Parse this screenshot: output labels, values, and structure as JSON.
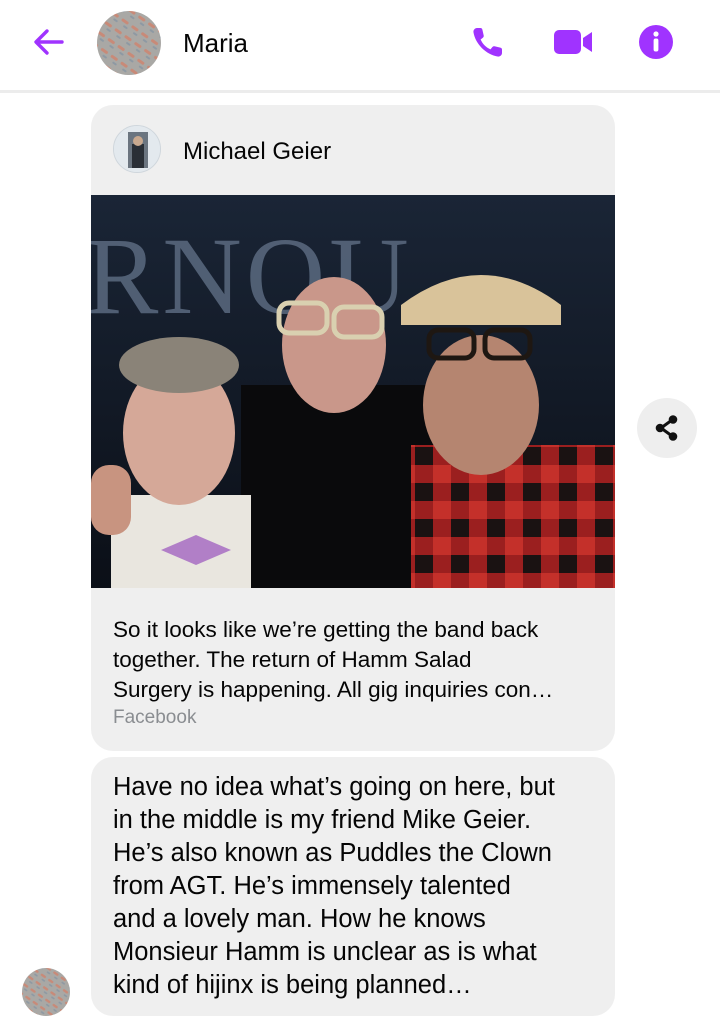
{
  "header": {
    "contact_name": "Maria",
    "back_icon": "arrow-left-icon",
    "actions": [
      "phone-icon",
      "video-camera-icon",
      "info-icon"
    ],
    "accent_color": "#a033ff"
  },
  "shared_post": {
    "author_name": "Michael Geier",
    "preview_text": "So it looks like we’re getting the band back together. The return of Hamm Salad Surgery is happening. All gig inquiries con…",
    "preview_lines": [
      "So it looks like we’re getting the band back",
      "together. The return of Hamm Salad",
      "Surgery is happening. All gig inquiries con…"
    ],
    "source": "Facebook",
    "photo_sign_text": "RNOU"
  },
  "message": {
    "lines": [
      "Have no idea what’s going on here, but",
      "in the middle is my friend Mike Geier.",
      "He’s also known as Puddles the Clown",
      "from AGT. He’s immensely talented",
      "and a lovely man. How he knows",
      "Monsieur Hamm is unclear as is what",
      "kind of hijinx is being planned…"
    ]
  },
  "share_button": {
    "icon": "share-icon"
  }
}
